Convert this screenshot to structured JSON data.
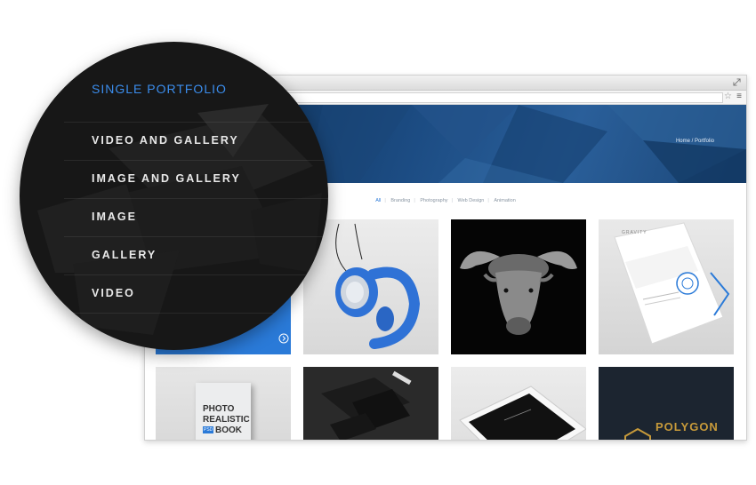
{
  "breadcrumb": "Home / Portfolio",
  "filters": [
    "All",
    "Branding",
    "Photography",
    "Web Design",
    "Animation"
  ],
  "active_filter": "All",
  "menu": {
    "items": [
      "SINGLE PORTFOLIO",
      "VIDEO AND GALLERY",
      "IMAGE AND GALLERY",
      "IMAGE",
      "GALLERY",
      "VIDEO"
    ],
    "active_index": 0
  },
  "tiles": {
    "book_title_1": "PHOTO",
    "book_title_2": "REALISTIC",
    "book_title_3": "BOOK",
    "book_badge": "PSD",
    "letter_brand": "GRAVITY",
    "logo_text": "POLYGON"
  },
  "colors": {
    "accent": "#3b8ded",
    "menu_bg": "#171717",
    "hero": "#1c4c83",
    "blue_tile": "#2a7ad8"
  },
  "icons": {
    "fullscreen": "fullscreen-icon",
    "star": "star-icon",
    "menu": "hamburger-menu-icon",
    "arrow": "arrow-right-circle-icon"
  }
}
